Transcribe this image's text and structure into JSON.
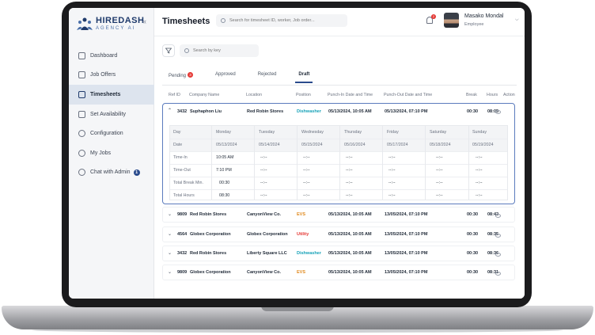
{
  "brand": {
    "name": "HIREDASH",
    "sub": "AGENCY AI"
  },
  "sidebar": {
    "items": [
      {
        "label": "Dashboard"
      },
      {
        "label": "Job Offers"
      },
      {
        "label": "Timesheets"
      },
      {
        "label": "Set Availability"
      },
      {
        "label": "Configuration"
      },
      {
        "label": "My Jobs"
      },
      {
        "label": "Chat with Admin",
        "badge": "1"
      }
    ]
  },
  "header": {
    "title": "Timesheets",
    "search_placeholder": "Search for timesheet ID, worker, Job order...",
    "notification_count": "2",
    "user_name": "Masako Mondal",
    "user_role": "Employee"
  },
  "toolbar": {
    "search_placeholder": "Search by key"
  },
  "tabs": [
    {
      "label": "Pending",
      "count": "3"
    },
    {
      "label": "Approved"
    },
    {
      "label": "Rejected"
    },
    {
      "label": "Draft"
    }
  ],
  "table": {
    "columns": [
      "Ref ID",
      "Company Name",
      "Location",
      "Position",
      "Punch-In Date and Time",
      "Punch-Out Date and Time",
      "Break",
      "Hours",
      "Action"
    ],
    "expanded_row": {
      "ref": "3432",
      "company": "Suphaphon Liu",
      "location": "Red Robin Stores",
      "position": "Dishwasher",
      "punch_in": "05/13/2024, 10:05 AM",
      "punch_out": "05/13/2024, 07:10 PM",
      "break": "00:30",
      "hours": "08:05",
      "detail": {
        "labels": [
          "Day",
          "Date",
          "Time-In",
          "Time-Out",
          "Total Break Min.",
          "Total Hours"
        ],
        "days": [
          {
            "day": "Monday",
            "date": "05/13/2024",
            "time_in": "10:05 AM",
            "time_out": "7:10 PM",
            "break": "00:30",
            "hours": "08:30"
          },
          {
            "day": "Tuesday",
            "date": "05/14/2024",
            "time_in": "--:--",
            "time_out": "--:--",
            "break": "--:--",
            "hours": "--:--"
          },
          {
            "day": "Wednesday",
            "date": "05/15/2024",
            "time_in": "--:--",
            "time_out": "--:--",
            "break": "--:--",
            "hours": "--:--"
          },
          {
            "day": "Thursday",
            "date": "05/16/2024",
            "time_in": "--:--",
            "time_out": "--:--",
            "break": "--:--",
            "hours": "--:--"
          },
          {
            "day": "Friday",
            "date": "05/17/2024",
            "time_in": "--:--",
            "time_out": "--:--",
            "break": "--:--",
            "hours": "--:--"
          },
          {
            "day": "Saturday",
            "date": "05/18/2024",
            "time_in": "--:--",
            "time_out": "--:--",
            "break": "--:--",
            "hours": "--:--"
          },
          {
            "day": "Sunday",
            "date": "05/19/2024",
            "time_in": "--:--",
            "time_out": "--:--",
            "break": "--:--",
            "hours": "--:--"
          }
        ]
      }
    },
    "rows": [
      {
        "ref": "9809",
        "company": "Red Robin Stores",
        "location": "CanyonView Co.",
        "position": "EVS",
        "punch_in": "05/13/2024, 10:05 AM",
        "punch_out": "13/05/2024, 07:10 PM",
        "break": "00:30",
        "hours": "08:42"
      },
      {
        "ref": "4564",
        "company": "Globex Corporation",
        "location": "Globex Corporation",
        "position": "Utility",
        "punch_in": "05/13/2024, 10:05 AM",
        "punch_out": "13/05/2024, 07:10 PM",
        "break": "00:30",
        "hours": "08:35"
      },
      {
        "ref": "3432",
        "company": "Red Robin Stores",
        "location": "Liberty Square LLC",
        "position": "Dishwasher",
        "punch_in": "05/13/2024, 10:05 AM",
        "punch_out": "13/05/2024, 07:10 PM",
        "break": "00:30",
        "hours": "08:36"
      },
      {
        "ref": "9809",
        "company": "Globex Corporation",
        "location": "CanyonView Co.",
        "position": "EVS",
        "punch_in": "05/13/2024, 10:05 AM",
        "punch_out": "13/05/2024, 07:10 PM",
        "break": "00:30",
        "hours": "08:31"
      }
    ]
  },
  "colors": {
    "accent": "#2a4b8d",
    "dishwasher": "#17a2b8",
    "evs": "#e08a1e",
    "utility": "#e53935"
  }
}
